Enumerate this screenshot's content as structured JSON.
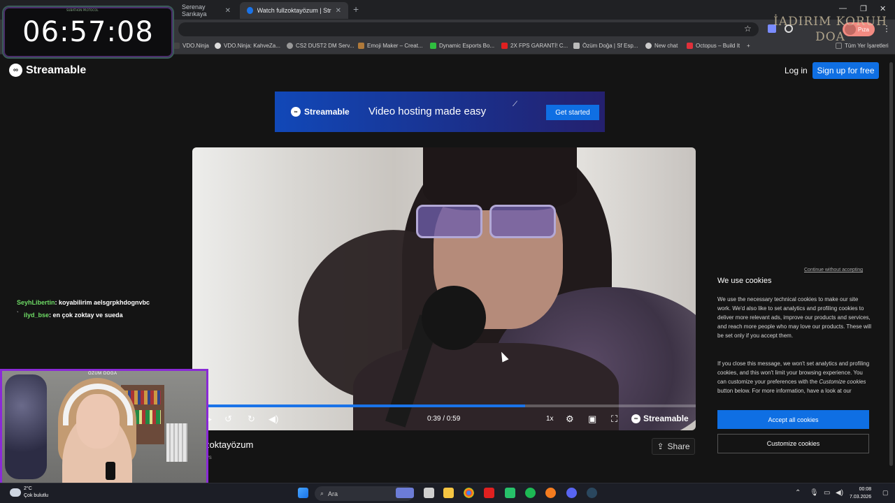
{
  "browser": {
    "tabs": [
      {
        "label": "Serenay Sarıkaya",
        "active": false
      },
      {
        "label": "Watch fullzoktayözum | Stream",
        "active": true
      }
    ],
    "new_tab_icon": "plus-icon",
    "bookmarks": [
      {
        "label": "VDO.Ninja",
        "color": "#444444"
      },
      {
        "label": "VDO.Ninja: KahveZa...",
        "color": "#dddddd"
      },
      {
        "label": "CS2 DUST2 DM Serv...",
        "color": "#999999"
      },
      {
        "label": "Emoji Maker – Creat...",
        "color": "#b07a3a"
      },
      {
        "label": "Dynamic Esports Bo...",
        "color": "#2fbf3f"
      },
      {
        "label": "2X FPS GARANTİ! C...",
        "color": "#e02020"
      },
      {
        "label": "Özüm Doğa | Sf Esp...",
        "color": "#bbbbbb"
      },
      {
        "label": "New chat",
        "color": "#cccccc"
      },
      {
        "label": "Octopus – Build It",
        "color": "#e0303a"
      },
      {
        "label": "Tüm Yer İşaretleri",
        "color": "#888888"
      }
    ],
    "profile_label": "Pıza",
    "overlay_text": "İADIRIM KORUH DOA"
  },
  "stream_timer": {
    "value": "06:57:08",
    "tiny": "SUBATHON PROTOCOL"
  },
  "streamable": {
    "brand": "Streamable",
    "login": "Log in",
    "signup": "Sign up for free",
    "banner": {
      "brand": "Streamable",
      "tagline": "Video hosting made easy",
      "cta": "Get started"
    },
    "player": {
      "time": "0:39 / 0:59",
      "progress": 0.661,
      "speed": "1x",
      "brand": "Streamable"
    },
    "video_title": "zoktayözum",
    "video_sub": "ws",
    "share": "Share"
  },
  "cookie": {
    "skip": "Continue without accepting",
    "title": "We use cookies",
    "p1": "We use the necessary technical cookies to make our site work. We'd also like to set analytics and profiling cookies to deliver more relevant ads, improve our products and services, and reach more people who may love our products. These will be set only if you accept them.",
    "p2_a": "If you close this message, we won't set analytics and profiling cookies, and this won't limit your browsing experience. You can customize your preferences with the ",
    "p2_em": "Customize cookies",
    "p2_b": " button below. For more information, have a look at our",
    "accept": "Accept all cookies",
    "customize": "Customize cookies"
  },
  "chat": [
    {
      "user": "SeyhLibertin",
      "msg": ": koyabilirim aelsgrpkhdognvbc"
    },
    {
      "user": "ilyd_bse",
      "msg": ": en çok zoktay ve sueda"
    }
  ],
  "webcam": {
    "label": "ÖZÜM DOĞA"
  },
  "taskbar": {
    "weather_temp": "2°C",
    "weather_desc": "Çok bulutlu",
    "search": "Ara",
    "time": "00:08",
    "date": "7.03.2026"
  }
}
